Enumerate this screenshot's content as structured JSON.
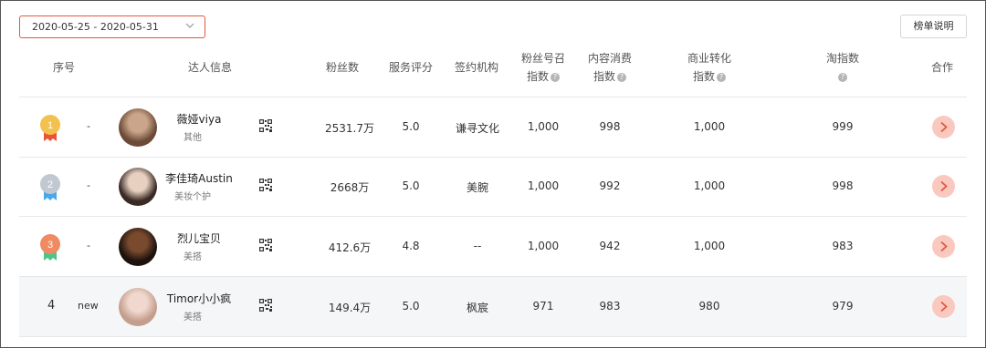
{
  "toolbar": {
    "date_range": "2020-05-25 - 2020-05-31",
    "explain_label": "榜单说明"
  },
  "headers": {
    "rank": "序号",
    "influencer": "达人信息",
    "fans": "粉丝数",
    "service": "服务评分",
    "agency": "签约机构",
    "fan_call_1": "粉丝号召",
    "fan_call_2": "指数",
    "content_1": "内容消费",
    "content_2": "指数",
    "commerce_1": "商业转化",
    "commerce_2": "指数",
    "tao_1": "淘指数",
    "coop": "合作"
  },
  "rows": [
    {
      "rank": "1",
      "trend": "-",
      "name": "薇娅viya",
      "category": "其他",
      "fans": "2531.7万",
      "service": "5.0",
      "agency": "谦寻文化",
      "fan_call": "1,000",
      "content": "998",
      "commerce": "1,000",
      "tao": "999",
      "medal_color": "#f2c14e",
      "ribbon_color": "#e8533a"
    },
    {
      "rank": "2",
      "trend": "-",
      "name": "李佳琦Austin",
      "category": "美妆个护",
      "fans": "2668万",
      "service": "5.0",
      "agency": "美腕",
      "fan_call": "1,000",
      "content": "992",
      "commerce": "1,000",
      "tao": "998",
      "medal_color": "#c2c8d0",
      "ribbon_color": "#4aa8e8"
    },
    {
      "rank": "3",
      "trend": "-",
      "name": "烈儿宝贝",
      "category": "美搭",
      "fans": "412.6万",
      "service": "4.8",
      "agency": "--",
      "fan_call": "1,000",
      "content": "942",
      "commerce": "1,000",
      "tao": "983",
      "medal_color": "#f08a62",
      "ribbon_color": "#4cc38a"
    },
    {
      "rank": "4",
      "trend": "new",
      "name": "Timor小小疯",
      "category": "美搭",
      "fans": "149.4万",
      "service": "5.0",
      "agency": "枫宸",
      "fan_call": "971",
      "content": "983",
      "commerce": "980",
      "tao": "979"
    }
  ],
  "icons": {
    "dropdown": "chevron-down-icon",
    "help": "question-icon",
    "qr": "qr-code-icon",
    "go": "chevron-right-icon"
  },
  "colors": {
    "accent": "#e4573d",
    "go_button": "#f9c9c0",
    "highlight_row": "#f5f6f7"
  }
}
